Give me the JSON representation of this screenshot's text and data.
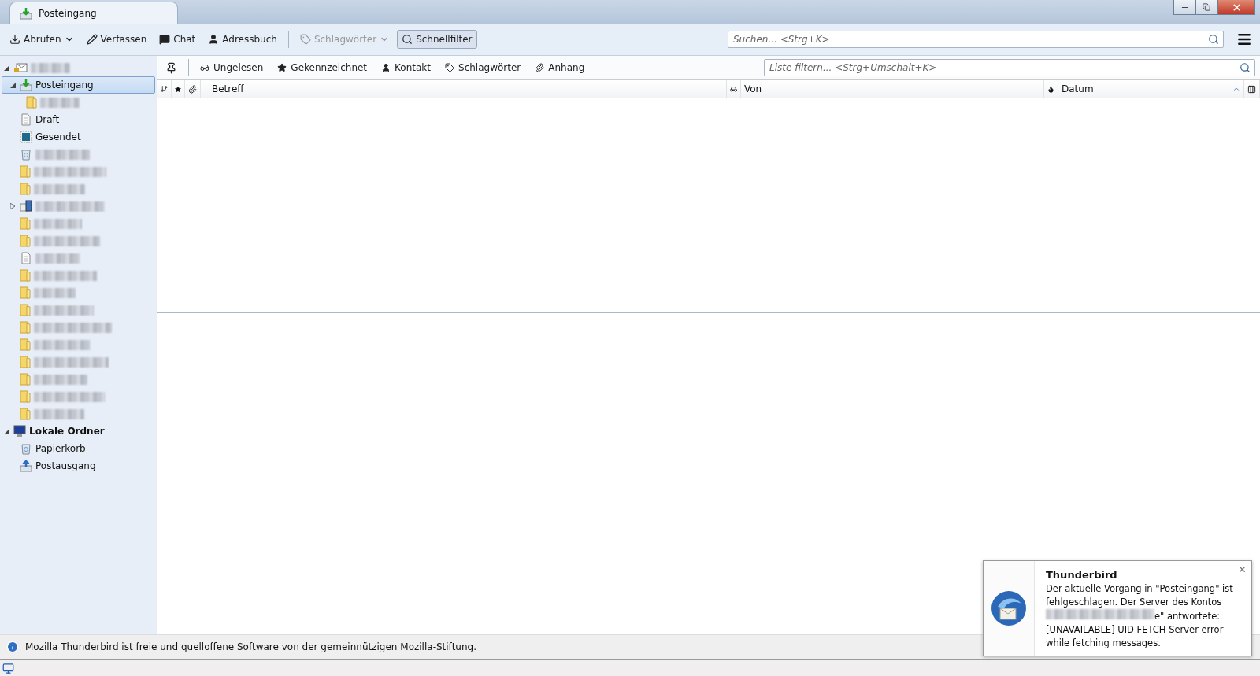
{
  "tab": {
    "title": "Posteingang",
    "selected": true
  },
  "toolbar": {
    "buttons": [
      {
        "label": "Abrufen",
        "dropdown": true,
        "disabled": false,
        "selected": false
      },
      {
        "label": "Verfassen",
        "dropdown": false,
        "disabled": false,
        "selected": false
      },
      {
        "label": "Chat",
        "dropdown": false,
        "disabled": false,
        "selected": false
      },
      {
        "label": "Adressbuch",
        "dropdown": false,
        "disabled": false,
        "selected": false
      },
      {
        "label": "Schlagwörter",
        "dropdown": true,
        "disabled": true,
        "selected": false
      },
      {
        "label": "Schnellfilter",
        "dropdown": false,
        "disabled": false,
        "selected": true
      }
    ],
    "search": {
      "placeholder": "Suchen... <Strg+K>"
    }
  },
  "folders": [
    {
      "kind": "account",
      "redacted": true,
      "expanded": true,
      "selected": false,
      "children": [
        {
          "kind": "inbox",
          "label": "Posteingang",
          "expanded": true,
          "selected": true,
          "children": [
            {
              "kind": "folder",
              "redacted": true,
              "selected": false
            }
          ]
        },
        {
          "kind": "draft",
          "label": "Draft",
          "selected": false
        },
        {
          "kind": "sent",
          "label": "Gesendet",
          "selected": false
        },
        {
          "kind": "trash",
          "redacted": true,
          "selected": false
        },
        {
          "kind": "folder",
          "redacted": true,
          "selected": false
        },
        {
          "kind": "folder",
          "redacted": true,
          "selected": false
        },
        {
          "kind": "server",
          "redacted": true,
          "expanded": false,
          "selected": false
        },
        {
          "kind": "folder",
          "redacted": true,
          "selected": false
        },
        {
          "kind": "folder",
          "redacted": true,
          "selected": false
        },
        {
          "kind": "draft",
          "redacted": true,
          "selected": false
        },
        {
          "kind": "folder",
          "redacted": true,
          "selected": false
        },
        {
          "kind": "folder",
          "redacted": true,
          "selected": false
        },
        {
          "kind": "folder",
          "redacted": true,
          "selected": false
        },
        {
          "kind": "folder",
          "redacted": true,
          "selected": false
        },
        {
          "kind": "folder",
          "redacted": true,
          "selected": false
        },
        {
          "kind": "folder",
          "redacted": true,
          "selected": false
        },
        {
          "kind": "folder",
          "redacted": true,
          "selected": false
        },
        {
          "kind": "folder",
          "redacted": true,
          "selected": false
        },
        {
          "kind": "folder",
          "redacted": true,
          "selected": false
        }
      ]
    },
    {
      "kind": "local",
      "label": "Lokale Ordner",
      "expanded": true,
      "selected": false,
      "children": [
        {
          "kind": "trash",
          "label": "Papierkorb",
          "selected": false
        },
        {
          "kind": "outbox",
          "label": "Postausgang",
          "selected": false
        }
      ]
    }
  ],
  "quick_filter": {
    "pinned": false,
    "filters": [
      {
        "label": "Ungelesen",
        "selected": false
      },
      {
        "label": "Gekennzeichnet",
        "selected": false
      },
      {
        "label": "Kontakt",
        "selected": false
      },
      {
        "label": "Schlagwörter",
        "selected": false
      },
      {
        "label": "Anhang",
        "selected": false
      }
    ],
    "placeholder": "Liste filtern... <Strg+Umschalt+K>"
  },
  "columns": [
    {
      "label": "Betreff"
    },
    {
      "label": "Von"
    },
    {
      "label": "Datum",
      "sort_ascending": true
    }
  ],
  "info_bar": {
    "text": "Mozilla Thunderbird ist freie und quelloffene Software von der gemeinnützigen Mozilla-Stiftung."
  },
  "notification": {
    "title": "Thunderbird",
    "message_before": "Der aktuelle Vorgang in \"Posteingang\" ist fehlgeschlagen. Der Server des Kontos",
    "message_after": "e\" antwortete: [UNAVAILABLE] UID FETCH Server error while fetching messages."
  }
}
